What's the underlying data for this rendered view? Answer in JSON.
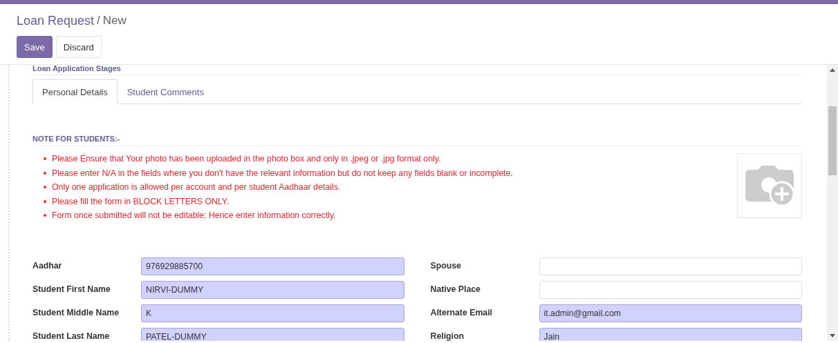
{
  "breadcrumb": {
    "title": "Loan Request",
    "separator": "/",
    "current": "New"
  },
  "buttons": [
    {
      "label": "Save",
      "kind": "primary"
    },
    {
      "label": "Discard",
      "kind": "secondary"
    }
  ],
  "section_title": "Loan Application Stages",
  "tabs": [
    {
      "label": "Personal Details",
      "selected": true
    },
    {
      "label": "Student Comments",
      "selected": false
    }
  ],
  "note": {
    "heading": "NOTE FOR STUDENTS:-",
    "items": [
      "Please Ensure that Your photo has been uploaded in the photo box and only in .jpeg or .jpg format only.",
      "Please enter N/A in the fields where you don't have the relevant information but do not keep any fields blank or incomplete.",
      "Only one application is allowed per account and per student Aadhaar details.",
      "Please fill the form in BLOCK LETTERS ONLY.",
      "Form once submitted will not be editable; Hence enter information correctly."
    ]
  },
  "fields_left": [
    {
      "label": "Aadhar",
      "value": "976929885700",
      "required": true
    },
    {
      "label": "Student First Name",
      "value": "NIRVI-DUMMY",
      "required": true
    },
    {
      "label": "Student Middle Name",
      "value": "K",
      "required": true
    },
    {
      "label": "Student Last Name",
      "value": "PATEL-DUMMY",
      "required": true
    }
  ],
  "fields_right": [
    {
      "label": "Spouse",
      "required": false
    },
    {
      "label": "Native Place",
      "required": false
    },
    {
      "label": "Alternate Email",
      "value": "it.admin@gmail.com",
      "required": true
    },
    {
      "label": "Religion",
      "value": "Jain",
      "required": true
    }
  ]
}
